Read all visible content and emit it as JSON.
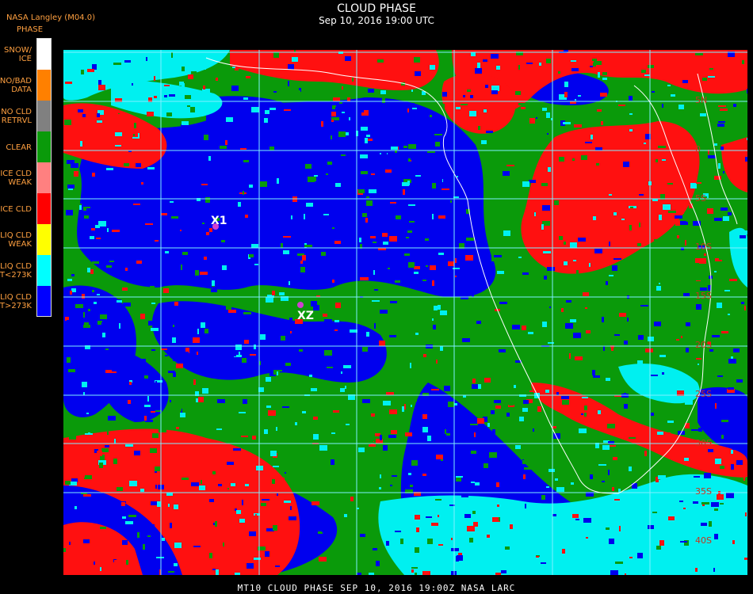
{
  "header": {
    "title": "CLOUD PHASE",
    "subtitle": "Sep 10, 2016 19:00 UTC",
    "source": "NASA Langley (M04.0)"
  },
  "legend": {
    "title": "PHASE",
    "items": [
      {
        "label": "SNOW/\nICE",
        "color": "#ffffff"
      },
      {
        "label": "NO/BAD\nDATA",
        "color": "#ff8000"
      },
      {
        "label": "NO CLD\nRETRVL",
        "color": "#808080"
      },
      {
        "label": "CLEAR",
        "color": "#0a9a0a"
      },
      {
        "label": "ICE CLD\nWEAK",
        "color": "#ff8080"
      },
      {
        "label": "ICE CLD",
        "color": "#ff0000"
      },
      {
        "label": "LIQ CLD\nWEAK",
        "color": "#ffff00"
      },
      {
        "label": "LIQ CLD\nT<273K",
        "color": "#00ffff"
      },
      {
        "label": "LIQ CLD\nT>273K",
        "color": "#0000ff"
      }
    ]
  },
  "map": {
    "markers": [
      {
        "label": "X1"
      },
      {
        "label": "XZ"
      }
    ],
    "lat_labels": [
      "5N",
      "0",
      "5S",
      "10S",
      "15S",
      "20S",
      "25S",
      "30S",
      "35S",
      "40S"
    ],
    "colors": {
      "clear": "#0a9a0a",
      "ice": "#ff1010",
      "liq_warm": "#0000ee",
      "liq_cold": "#00f0f0",
      "grid": "#7ff0ff",
      "marker": "#d040d0"
    }
  },
  "footer": {
    "text": "MT10  CLOUD PHASE   SEP 10, 2016 19:00Z   NASA LARC"
  }
}
